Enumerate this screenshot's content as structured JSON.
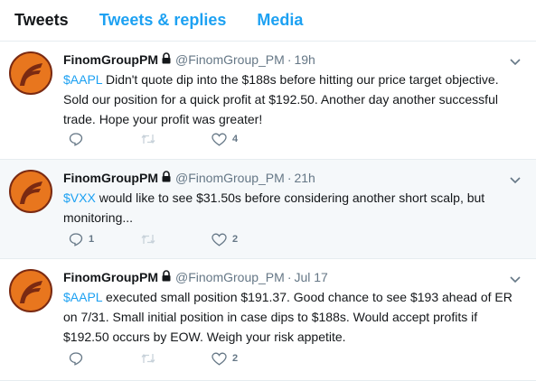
{
  "tabs": [
    {
      "label": "Tweets",
      "active": true
    },
    {
      "label": "Tweets & replies",
      "active": false
    },
    {
      "label": "Media",
      "active": false
    }
  ],
  "tweets": [
    {
      "name": "FinomGroupPM",
      "handle": "@FinomGroup_PM",
      "separator": "·",
      "time": "19h",
      "cashtag": "$AAPL",
      "text": " Didn't quote dip into the $188s before hitting our price target objective. Sold our position for a quick profit at $192.50. Another day another successful trade. Hope your profit was greater!",
      "reply_count": "",
      "retweet_count": "",
      "like_count": "4"
    },
    {
      "name": "FinomGroupPM",
      "handle": "@FinomGroup_PM",
      "separator": "·",
      "time": "21h",
      "cashtag": "$VXX",
      "text": " would like to see $31.50s before considering another short scalp, but monitoring...",
      "reply_count": "1",
      "retweet_count": "",
      "like_count": "2"
    },
    {
      "name": "FinomGroupPM",
      "handle": "@FinomGroup_PM",
      "separator": "·",
      "time": "Jul 17",
      "cashtag": "$AAPL",
      "text": " executed small position $191.37. Good chance to see $193 ahead of ER on 7/31. Small initial position in case dips to $188s. Would accept profits if $192.50 occurs by EOW. Weigh your risk appetite.",
      "reply_count": "",
      "retweet_count": "",
      "like_count": "2"
    }
  ],
  "colors": {
    "accent": "#1da1f2",
    "muted": "#657786",
    "text": "#14171a",
    "avatar_orange": "#e8761e",
    "avatar_dark": "#7a2a12",
    "hover_bg": "#f5f8fa"
  },
  "icons": {
    "lock": "lock-icon",
    "chevron": "chevron-down-icon",
    "reply": "reply-icon",
    "retweet": "retweet-icon",
    "like": "heart-icon"
  }
}
